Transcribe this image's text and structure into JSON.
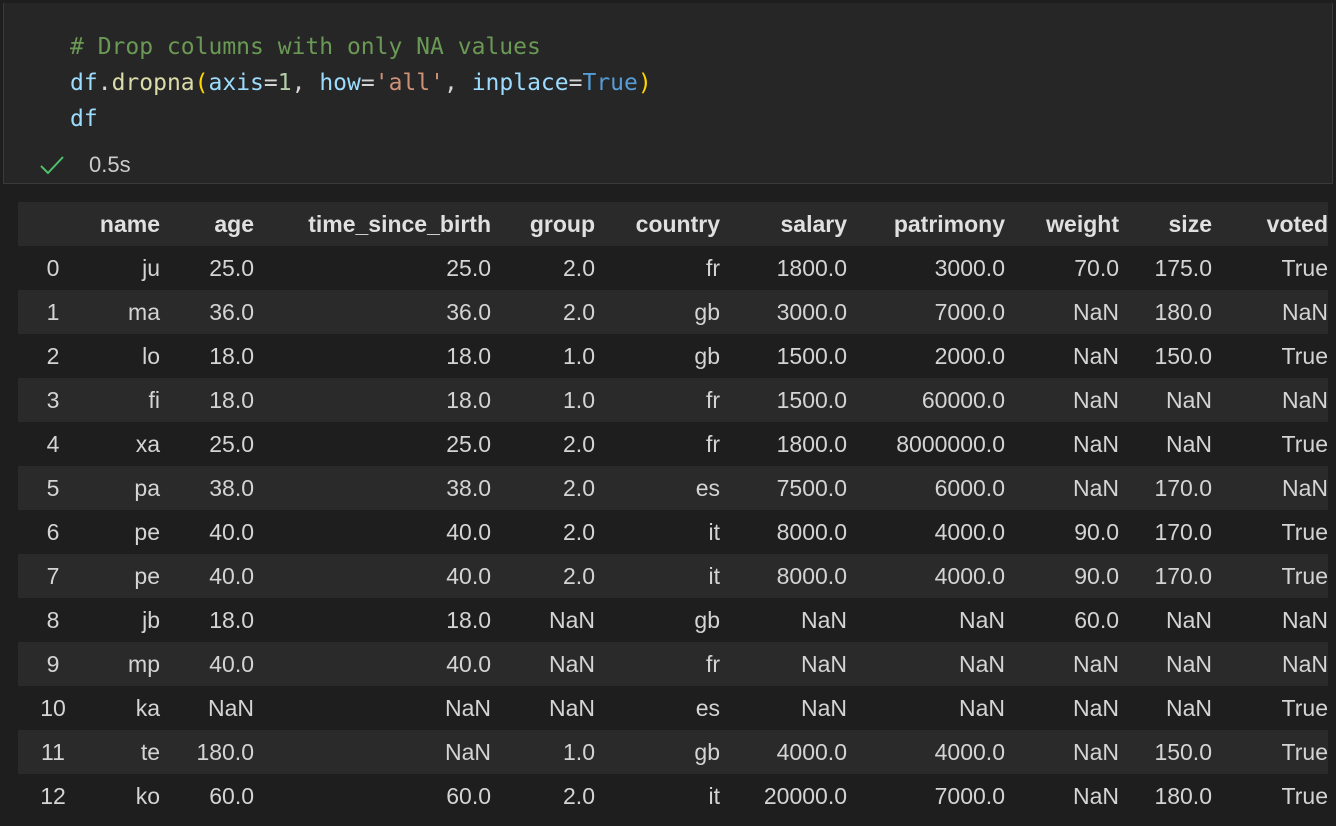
{
  "code_cell": {
    "lines": [
      [
        {
          "t": "# Drop columns with only NA values",
          "c": "comment"
        }
      ],
      [
        {
          "t": "df",
          "c": "var"
        },
        {
          "t": ".",
          "c": "punct"
        },
        {
          "t": "dropna",
          "c": "func"
        },
        {
          "t": "(",
          "c": "paren"
        },
        {
          "t": "axis",
          "c": "var"
        },
        {
          "t": "=",
          "c": "punct"
        },
        {
          "t": "1",
          "c": "num"
        },
        {
          "t": ", ",
          "c": "punct"
        },
        {
          "t": "how",
          "c": "var"
        },
        {
          "t": "=",
          "c": "punct"
        },
        {
          "t": "'all'",
          "c": "str"
        },
        {
          "t": ", ",
          "c": "punct"
        },
        {
          "t": "inplace",
          "c": "var"
        },
        {
          "t": "=",
          "c": "punct"
        },
        {
          "t": "True",
          "c": "kw"
        },
        {
          "t": ")",
          "c": "paren"
        }
      ],
      [
        {
          "t": "df",
          "c": "var"
        }
      ]
    ],
    "status": {
      "icon": "check-icon",
      "icon_color": "#4ec26b",
      "exec_time": "0.5s"
    }
  },
  "dataframe": {
    "columns": [
      "",
      "name",
      "age",
      "time_since_birth",
      "group",
      "country",
      "salary",
      "patrimony",
      "weight",
      "size",
      "voted"
    ],
    "rows": [
      [
        "0",
        "ju",
        "25.0",
        "25.0",
        "2.0",
        "fr",
        "1800.0",
        "3000.0",
        "70.0",
        "175.0",
        "True"
      ],
      [
        "1",
        "ma",
        "36.0",
        "36.0",
        "2.0",
        "gb",
        "3000.0",
        "7000.0",
        "NaN",
        "180.0",
        "NaN"
      ],
      [
        "2",
        "lo",
        "18.0",
        "18.0",
        "1.0",
        "gb",
        "1500.0",
        "2000.0",
        "NaN",
        "150.0",
        "True"
      ],
      [
        "3",
        "fi",
        "18.0",
        "18.0",
        "1.0",
        "fr",
        "1500.0",
        "60000.0",
        "NaN",
        "NaN",
        "NaN"
      ],
      [
        "4",
        "xa",
        "25.0",
        "25.0",
        "2.0",
        "fr",
        "1800.0",
        "8000000.0",
        "NaN",
        "NaN",
        "True"
      ],
      [
        "5",
        "pa",
        "38.0",
        "38.0",
        "2.0",
        "es",
        "7500.0",
        "6000.0",
        "NaN",
        "170.0",
        "NaN"
      ],
      [
        "6",
        "pe",
        "40.0",
        "40.0",
        "2.0",
        "it",
        "8000.0",
        "4000.0",
        "90.0",
        "170.0",
        "True"
      ],
      [
        "7",
        "pe",
        "40.0",
        "40.0",
        "2.0",
        "it",
        "8000.0",
        "4000.0",
        "90.0",
        "170.0",
        "True"
      ],
      [
        "8",
        "jb",
        "18.0",
        "18.0",
        "NaN",
        "gb",
        "NaN",
        "NaN",
        "60.0",
        "NaN",
        "NaN"
      ],
      [
        "9",
        "mp",
        "40.0",
        "40.0",
        "NaN",
        "fr",
        "NaN",
        "NaN",
        "NaN",
        "NaN",
        "NaN"
      ],
      [
        "10",
        "ka",
        "NaN",
        "NaN",
        "NaN",
        "es",
        "NaN",
        "NaN",
        "NaN",
        "NaN",
        "True"
      ],
      [
        "11",
        "te",
        "180.0",
        "NaN",
        "1.0",
        "gb",
        "4000.0",
        "4000.0",
        "NaN",
        "150.0",
        "True"
      ],
      [
        "12",
        "ko",
        "60.0",
        "60.0",
        "2.0",
        "it",
        "20000.0",
        "7000.0",
        "NaN",
        "180.0",
        "True"
      ]
    ]
  }
}
